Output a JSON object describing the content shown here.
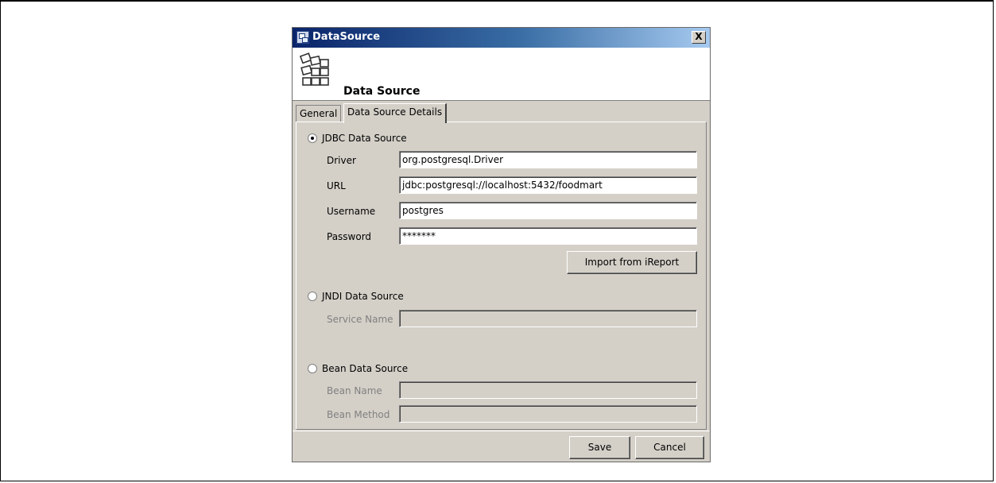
{
  "window": {
    "title": "DataSource",
    "close_glyph": "X"
  },
  "header": {
    "title": "Data Source",
    "icon": "data-source-icon"
  },
  "tabs": [
    {
      "label": "General",
      "active": false
    },
    {
      "label": "Data Source Details",
      "active": true
    }
  ],
  "jdbc": {
    "label": "JDBC Data Source",
    "selected": true,
    "driver_label": "Driver",
    "driver_value": "org.postgresql.Driver",
    "url_label": "URL",
    "url_value": "jdbc:postgresql://localhost:5432/foodmart",
    "username_label": "Username",
    "username_value": "postgres",
    "password_label": "Password",
    "password_value": "*******",
    "import_button": "Import from iReport"
  },
  "jndi": {
    "label": "JNDI Data Source",
    "selected": false,
    "service_name_label": "Service Name",
    "service_name_value": ""
  },
  "bean": {
    "label": "Bean Data Source",
    "selected": false,
    "bean_name_label": "Bean Name",
    "bean_name_value": "",
    "bean_method_label": "Bean Method",
    "bean_method_value": ""
  },
  "footer": {
    "save_label": "Save",
    "cancel_label": "Cancel"
  }
}
